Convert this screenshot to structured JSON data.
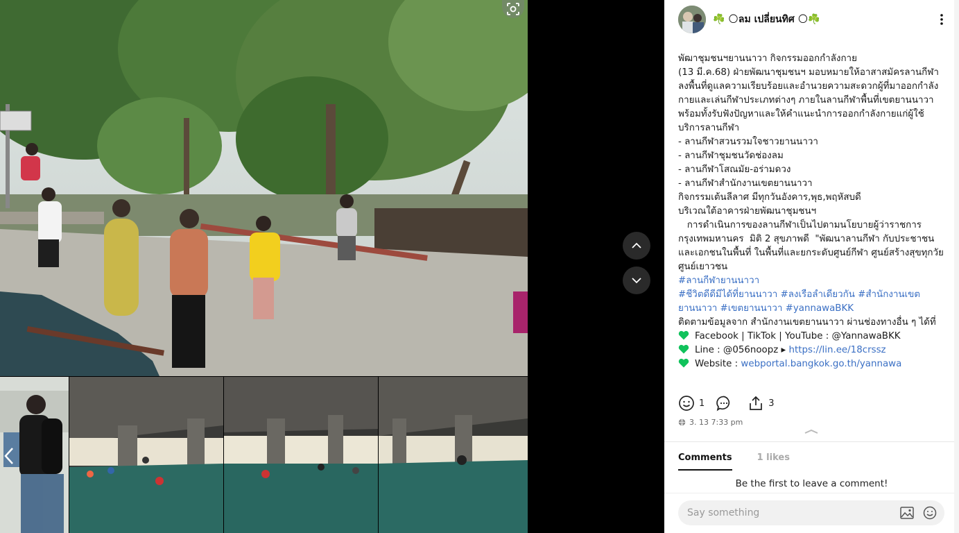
{
  "author": {
    "name": "☘️ 🌕ลม เปลี่ยนทิศ 🌕☘️"
  },
  "post": {
    "title": "พัฒาชุมชนฯยานนาวา กิจกรรมออกกำลังกาย",
    "intro": " (13 มี.ค.68)  ฝ่ายพัฒนาชุมชนฯ มอบหมายให้อาสาสมัครลานกีฬา ลงพื้นที่ดูแลความเรียบร้อยและอำนวยความสะดวกผู้ที่มาออกกำลังกายและเล่นกีฬาประเภทต่างๆ ภายในลานกีฬาพื้นที่เขตยานนาวา พร้อมทั้งรับฟังปัญหาและให้คำแนะนำการออกกำลังกายแก่ผู้ใช้บริการลานกีฬา",
    "list": [
      "- ลานกีฬาสวนรวมใจชาวยานนาวา",
      "- ลานกีฬาชุมชนวัดช่องลม",
      "- ลานกีฬาโสณมัย-อร่ามดวง",
      "- ลานกีฬาสำนักงานเขตยานนาวา"
    ],
    "schedule": "กิจกรรมเต้นลีลาศ มีทุกวันอังคาร,พุธ,พฤหัสบดี",
    "location": "บริเวณใต้อาคารฝ่ายพัฒนาชุมชนฯ",
    "policy": "   การดำเนินการของลานกีฬาเป็นไปตามนโยบายผู้ว่าราชการกรุงเทพมหานคร  มิติ 2 สุขภาพดี  \"พัฒนาลานกีฬา กับประชาชนและเอกชนในพื้นที่ ในพื้นที่และยกระดับศูนย์กีฬา ศูนย์สร้างสุขทุกวัย ศูนย์เยาวชน",
    "hashtag1": "#ลานกีฬายานนาวา",
    "hashtag2": "#ชีวิตดีดีมีได้ที่ยานนาวา #ลงเรือลำเดียวกัน #สำนักงานเขตยานนาวา #เขตยานนาวา #yannawaBKK",
    "follow": "ติดตามข้อมูลจาก สำนักงานเขตยานนาวา ผ่านช่องทางอื่น ๆ ได้ที่",
    "contact_facebook": "Facebook | TikTok | YouTube : @YannawaBKK",
    "contact_line_prefix": "Line : @056noopz ▸ ",
    "contact_line_link": "https://lin.ee/18crssz",
    "contact_web_prefix": "Website : ",
    "contact_web_link": "webportal.bangkok.go.th/yannawa"
  },
  "actions": {
    "reactions": "1",
    "comments": "",
    "shares": "3"
  },
  "timestamp": "3. 13 7:33 pm",
  "comments": {
    "tab_comments": "Comments",
    "tab_likes": "1 likes",
    "empty": "Be the first to leave a comment!",
    "placeholder": "Say something"
  },
  "colors": {
    "accent_link": "#3a6fc4",
    "heart": "#10c25b",
    "panel_bg": "#ffffff",
    "viewer_bg": "#000000"
  }
}
